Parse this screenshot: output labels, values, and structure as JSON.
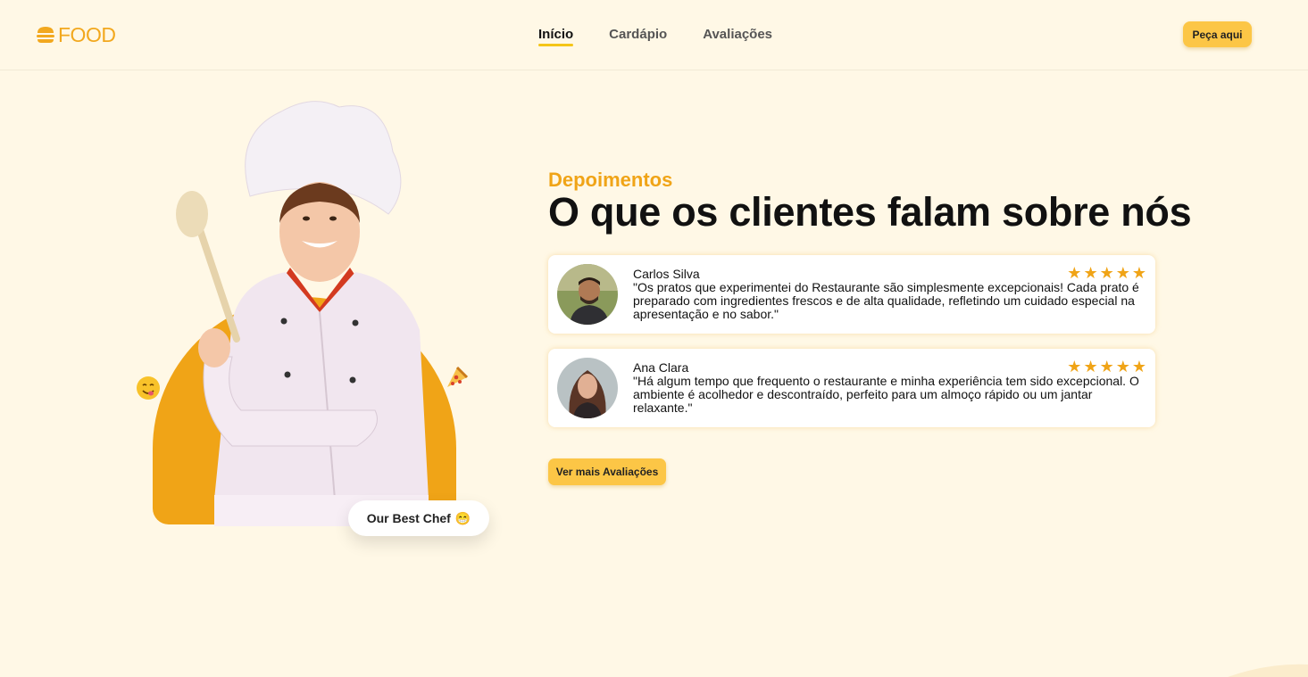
{
  "logo": {
    "text": "FOOD"
  },
  "nav": {
    "items": [
      {
        "label": "Início"
      },
      {
        "label": "Cardápio"
      },
      {
        "label": "Avaliações"
      }
    ]
  },
  "header": {
    "cta_label": "Peça aqui"
  },
  "hero": {
    "badge_label": "Our Best Chef",
    "badge_emoji": "😁"
  },
  "testimonials": {
    "label": "Depoimentos",
    "title": "O que os clientes falam sobre nós",
    "items": [
      {
        "name": "Carlos Silva",
        "quote": "\"Os pratos que experimentei do Restaurante são simplesmente excepcionais! Cada prato é preparado com ingredientes frescos e de alta qualidade, refletindo um cuidado especial na apresentação e no sabor.\"",
        "rating": 5
      },
      {
        "name": "Ana Clara",
        "quote": "\"Há algum tempo que frequento o restaurante e minha experiência tem sido excepcional. O ambiente é acolhedor e descontraído, perfeito para um almoço rápido ou um jantar relaxante.\"",
        "rating": 5
      }
    ],
    "more_label": "Ver mais Avaliações"
  },
  "colors": {
    "accent": "#f0a417",
    "button": "#fcc646",
    "background": "#fff8e6"
  }
}
